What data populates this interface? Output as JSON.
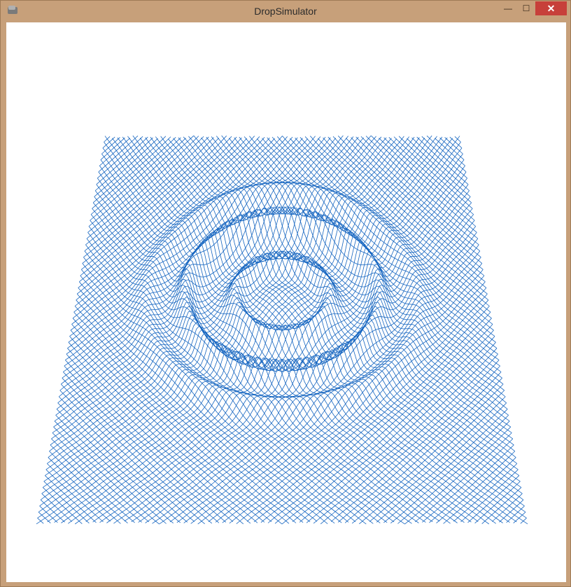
{
  "window": {
    "title": "DropSimulator",
    "icon": "app-icon",
    "controls": {
      "minimize_icon": "minimize-icon",
      "maximize_icon": "maximize-icon",
      "close_icon": "close-icon",
      "minimize_label": "—",
      "maximize_label": "☐",
      "close_label": "✕"
    }
  },
  "scene": {
    "description_type": "wireframe-mesh",
    "mesh_color": "#1565c0",
    "background_color": "#ffffff",
    "wave_rings": 3
  },
  "colors": {
    "frame": "#c7a07a",
    "close_button": "#c7403a",
    "mesh": "#1565c0"
  }
}
